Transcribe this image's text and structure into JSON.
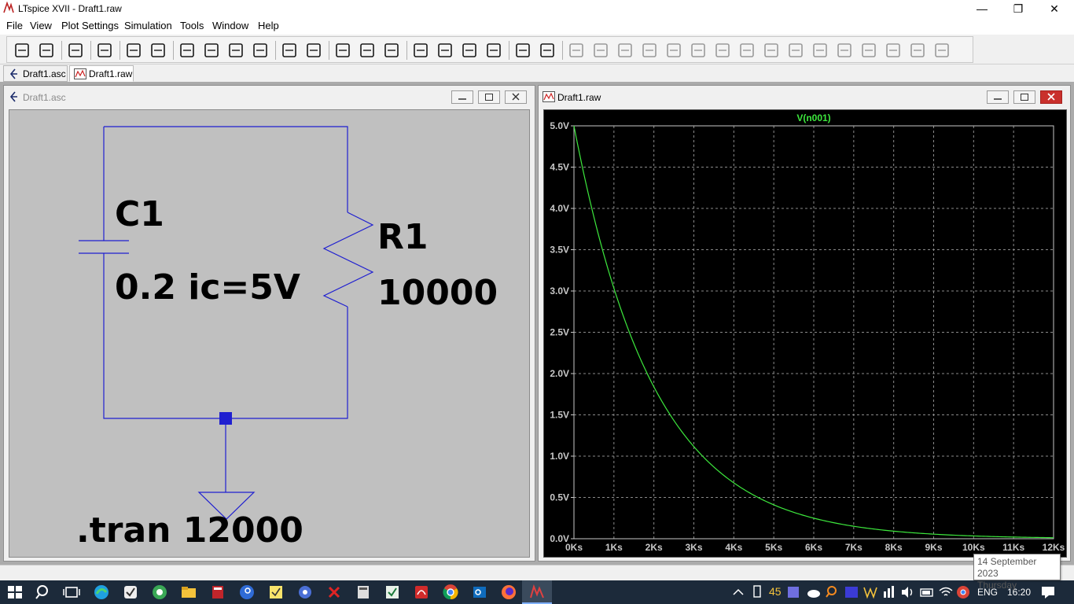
{
  "window": {
    "title": "LTspice XVII - Draft1.raw"
  },
  "menu": [
    "File",
    "View",
    "Plot Settings",
    "Simulation",
    "Tools",
    "Window",
    "Help"
  ],
  "toolbar_icons": [
    "run-icon",
    "open-icon",
    "save-icon",
    "control-panel-icon",
    "halt-icon",
    "pan-icon",
    "zoom-in-icon",
    "zoom-area-icon",
    "zoom-out-icon",
    "zoom-fit-icon",
    "autorange-icon",
    "manual-limits-icon",
    "tile-horizontal-icon",
    "cascade-icon",
    "tile-vertical-icon",
    "cut-icon",
    "copy-icon",
    "paste-icon",
    "find-icon",
    "print-setup-icon",
    "print-icon",
    "wire-icon",
    "ground-icon",
    "label-icon",
    "resistor-icon",
    "capacitor-icon",
    "inductor-icon",
    "diode-icon",
    "component-icon",
    "move-icon",
    "drag-icon",
    "undo-icon",
    "redo-icon",
    "rotate-icon",
    "mirror-icon",
    "text-icon",
    "spice-directive-icon"
  ],
  "tabs": [
    {
      "label": "Draft1.asc",
      "active": false
    },
    {
      "label": "Draft1.raw",
      "active": true
    }
  ],
  "schematic": {
    "title": "Draft1.asc",
    "cap_name": "C1",
    "cap_value": "0.2 ic=5V",
    "res_name": "R1",
    "res_value": "10000",
    "directive": ".tran 12000",
    "wire_color": "#1f1fd0"
  },
  "plot": {
    "title": "Draft1.raw",
    "trace_color": "#3de83d"
  },
  "chart_data": {
    "type": "line",
    "series": [
      {
        "name": "V(n001)",
        "color": "#3de83d",
        "function": "5*exp(-t/2000)"
      }
    ],
    "x": [
      0,
      500,
      1000,
      1500,
      2000,
      2500,
      3000,
      4000,
      5000,
      6000,
      7000,
      8000,
      9000,
      10000,
      11000,
      12000
    ],
    "y": [
      5.0,
      3.89,
      3.03,
      2.36,
      1.84,
      1.43,
      1.12,
      0.68,
      0.41,
      0.25,
      0.15,
      0.09,
      0.06,
      0.03,
      0.02,
      0.01
    ],
    "xlim": [
      0,
      12000
    ],
    "ylim": [
      0,
      5
    ],
    "x_ticks": [
      "0Ks",
      "1Ks",
      "2Ks",
      "3Ks",
      "4Ks",
      "5Ks",
      "6Ks",
      "7Ks",
      "8Ks",
      "9Ks",
      "10Ks",
      "11Ks",
      "12Ks"
    ],
    "y_ticks": [
      "0.0V",
      "0.5V",
      "1.0V",
      "1.5V",
      "2.0V",
      "2.5V",
      "3.0V",
      "3.5V",
      "4.0V",
      "4.5V",
      "5.0V"
    ],
    "grid": true
  },
  "taskbar": {
    "temperature": "45",
    "language": "ENG",
    "time": "16:20"
  },
  "tooltip": {
    "date": "14 September 2023",
    "day": "Thursday"
  }
}
